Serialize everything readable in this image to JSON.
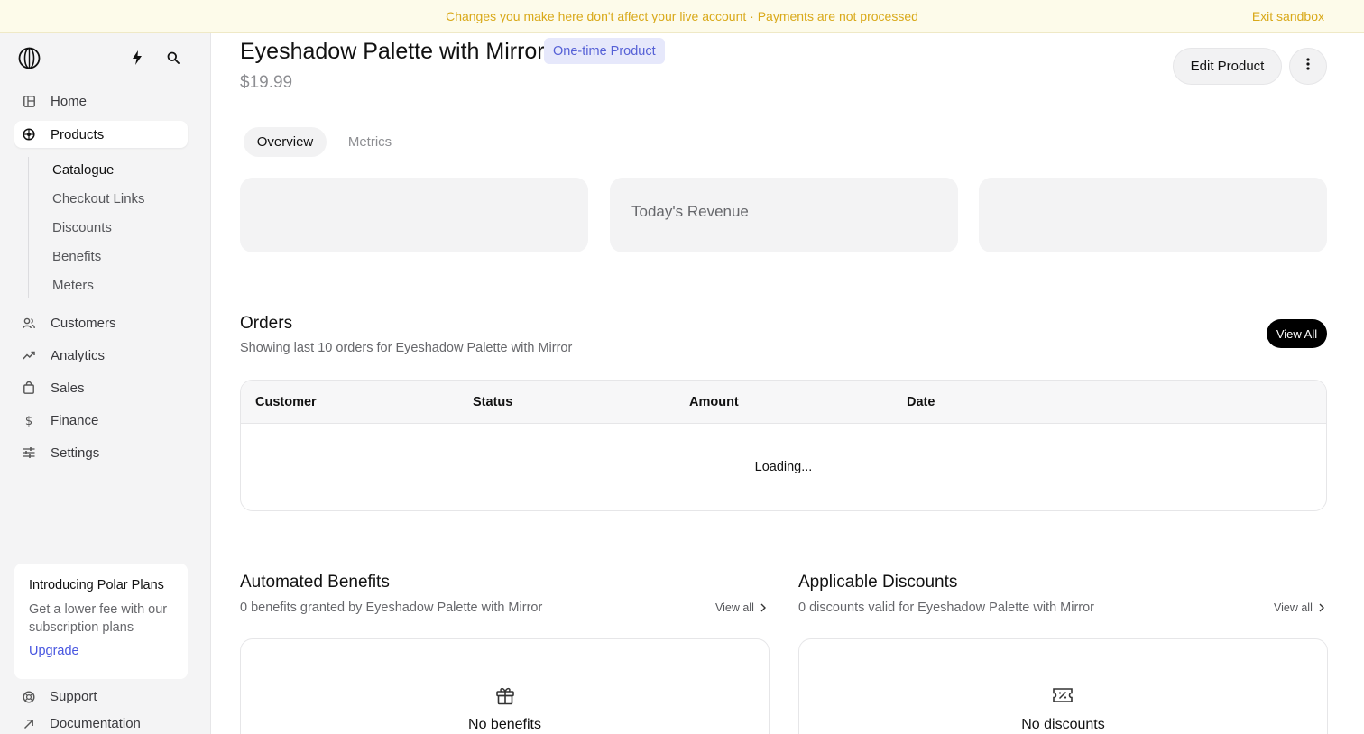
{
  "banner": {
    "message": "Changes you make here don't affect your live account · Payments are not processed",
    "exit_label": "Exit sandbox"
  },
  "sidebar": {
    "nav": [
      {
        "label": "Home",
        "icon": "home-icon"
      },
      {
        "label": "Products",
        "icon": "products-icon"
      },
      {
        "label": "Customers",
        "icon": "customers-icon"
      },
      {
        "label": "Analytics",
        "icon": "analytics-icon"
      },
      {
        "label": "Sales",
        "icon": "sales-icon"
      },
      {
        "label": "Finance",
        "icon": "finance-icon"
      },
      {
        "label": "Settings",
        "icon": "settings-icon"
      }
    ],
    "sub_nav": [
      "Catalogue",
      "Checkout Links",
      "Discounts",
      "Benefits",
      "Meters"
    ],
    "promo": {
      "title": "Introducing Polar Plans",
      "body": "Get a lower fee with our subscription plans",
      "link": "Upgrade"
    },
    "footer": [
      {
        "label": "Support",
        "icon": "support-icon"
      },
      {
        "label": "Documentation",
        "icon": "external-link-icon"
      }
    ]
  },
  "product": {
    "name": "Eyeshadow Palette with Mirror",
    "type_badge": "One-time Product",
    "price": "$19.99",
    "edit_label": "Edit Product"
  },
  "tabs": [
    "Overview",
    "Metrics"
  ],
  "stats": {
    "todays_revenue_label": "Today's Revenue"
  },
  "orders": {
    "title": "Orders",
    "subtitle": "Showing last 10 orders for Eyeshadow Palette with Mirror",
    "view_all": "View All",
    "columns": [
      "Customer",
      "Status",
      "Amount",
      "Date"
    ],
    "loading_text": "Loading..."
  },
  "benefits": {
    "title": "Automated Benefits",
    "subtitle": "0 benefits granted by Eyeshadow Palette with Mirror",
    "view_all": "View all",
    "empty_text": "No benefits"
  },
  "discounts": {
    "title": "Applicable Discounts",
    "subtitle": "0 discounts valid for Eyeshadow Palette with Mirror",
    "view_all": "View all",
    "empty_text": "No discounts"
  },
  "colors": {
    "banner_text": "#d9a91a",
    "badge_bg": "#e6e8fb",
    "badge_text": "#5560d6",
    "link": "#4856e0"
  }
}
